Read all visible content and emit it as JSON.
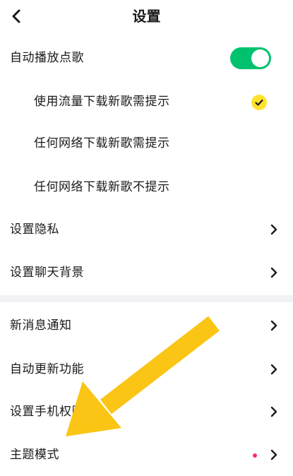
{
  "header": {
    "title": "设置"
  },
  "toggle_row": {
    "label": "自动播放点歌",
    "enabled": true
  },
  "download_options": [
    {
      "label": "使用流量下载新歌需提示",
      "selected": true
    },
    {
      "label": "任何网络下载新歌需提示",
      "selected": false
    },
    {
      "label": "任何网络下载新歌不提示",
      "selected": false
    }
  ],
  "group1": [
    {
      "label": "设置隐私"
    },
    {
      "label": "设置聊天背景"
    }
  ],
  "group2": [
    {
      "label": "新消息通知"
    },
    {
      "label": "自动更新功能"
    },
    {
      "label": "设置手机权限"
    },
    {
      "label": "主题模式",
      "badge": "new-dot"
    }
  ],
  "colors": {
    "toggle_on": "#00c26e",
    "check": "#ffe22e",
    "badge_dot": "#ff2a68",
    "arrow": "#fbc515"
  }
}
